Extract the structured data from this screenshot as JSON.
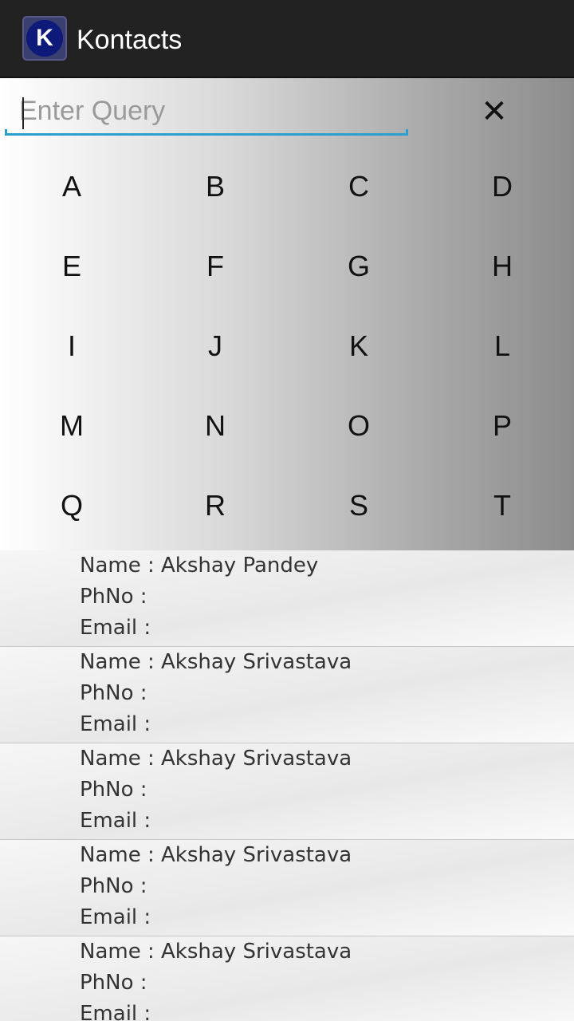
{
  "app": {
    "title": "Kontacts",
    "logo_letter": "K"
  },
  "search": {
    "placeholder": "Enter Query",
    "value": "",
    "clear_icon": "✕"
  },
  "keypad": {
    "letters": [
      "A",
      "B",
      "C",
      "D",
      "E",
      "F",
      "G",
      "H",
      "I",
      "J",
      "K",
      "L",
      "M",
      "N",
      "O",
      "P",
      "Q",
      "R",
      "S",
      "T"
    ]
  },
  "labels": {
    "name": "Name : ",
    "phone": "PhNo : ",
    "email": "Email : "
  },
  "contacts": [
    {
      "name": "Akshay Pandey",
      "phone": "",
      "email": ""
    },
    {
      "name": "Akshay Srivastava",
      "phone": "",
      "email": ""
    },
    {
      "name": "Akshay Srivastava",
      "phone": "",
      "email": ""
    },
    {
      "name": "Akshay Srivastava",
      "phone": "",
      "email": ""
    },
    {
      "name": "Akshay Srivastava",
      "phone": "",
      "email": ""
    }
  ],
  "colors": {
    "action_bar": "#222222",
    "accent": "#2aa0cf",
    "logo_bg": "#0d1a7a"
  }
}
